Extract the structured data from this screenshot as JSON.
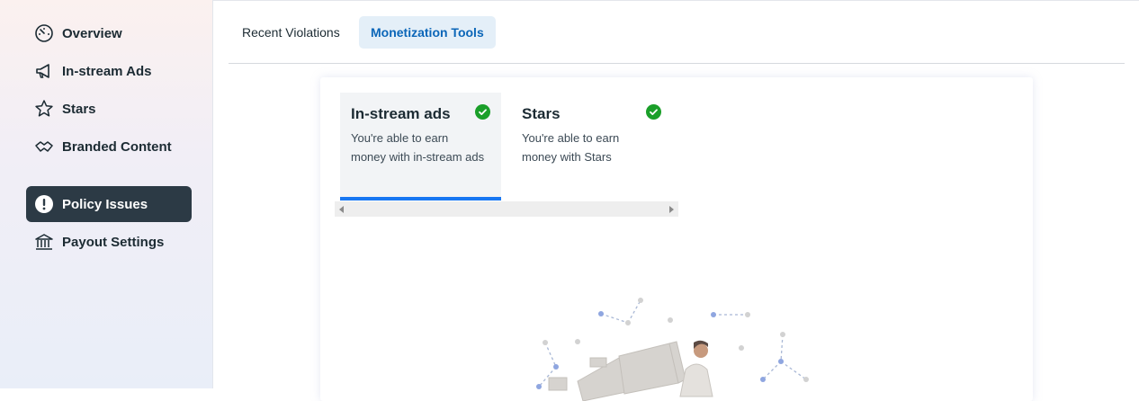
{
  "sidebar": {
    "items": [
      {
        "label": "Overview",
        "icon": "gauge-icon"
      },
      {
        "label": "In-stream Ads",
        "icon": "megaphone-icon"
      },
      {
        "label": "Stars",
        "icon": "star-icon"
      },
      {
        "label": "Branded Content",
        "icon": "handshake-icon"
      },
      {
        "label": "Policy Issues",
        "icon": "alert-circle-icon",
        "active": true
      },
      {
        "label": "Payout Settings",
        "icon": "bank-icon"
      }
    ]
  },
  "tabs": [
    {
      "label": "Recent Violations"
    },
    {
      "label": "Monetization Tools",
      "selected": true
    }
  ],
  "tools": [
    {
      "title": "In-stream ads",
      "description": "You're able to earn money with in-stream ads",
      "status": "eligible"
    },
    {
      "title": "Stars",
      "description": "You're able to earn money with Stars",
      "status": "eligible"
    }
  ],
  "colors": {
    "active_nav_bg": "#2c3a45",
    "selected_tab_text": "#0b66b8",
    "check_green": "#1a9f29",
    "selected_underline": "#1877f2"
  }
}
